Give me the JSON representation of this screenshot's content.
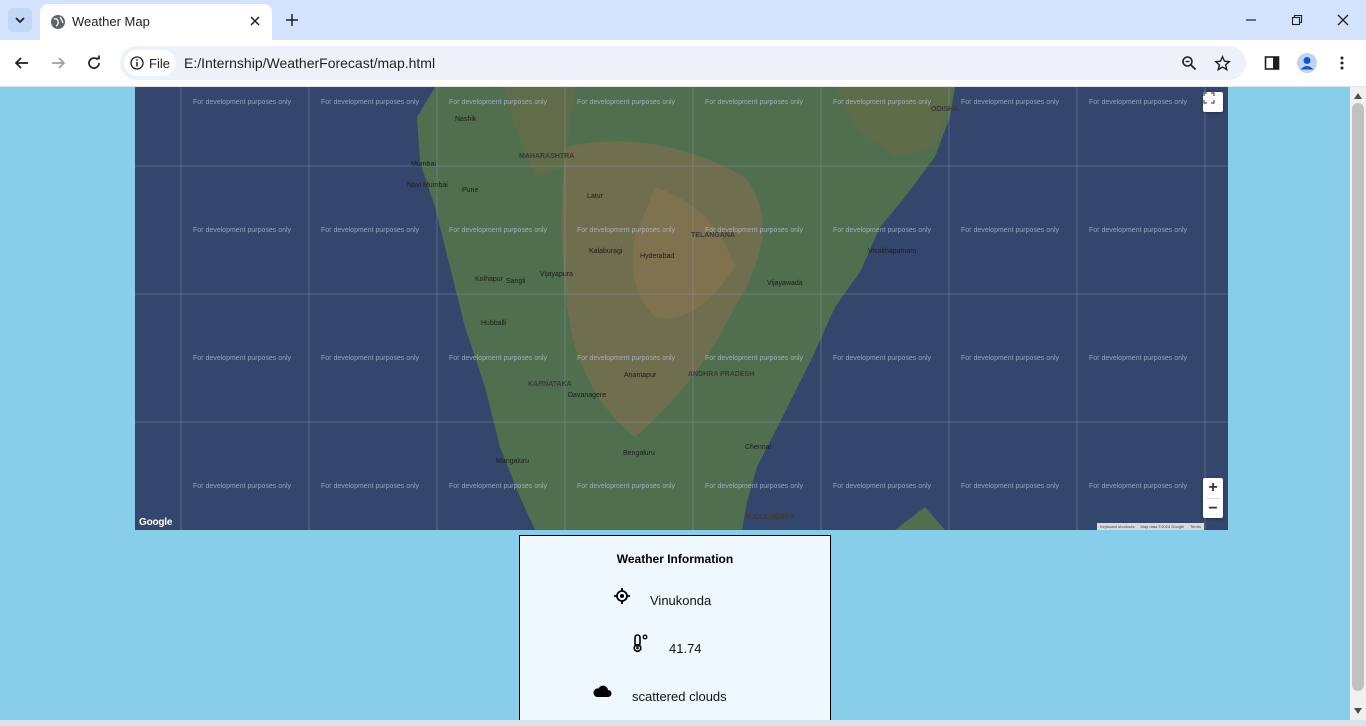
{
  "browser": {
    "tab_title": "Weather Map",
    "address_chip": "File",
    "url": "E:/Internship/WeatherForecast/map.html"
  },
  "map": {
    "watermark": "For development purposes only",
    "labels": [
      "Nashik",
      "MAHARASHTRA",
      "Mumbai",
      "Navi Mumbai",
      "Pune",
      "Latur",
      "Kalaburagi",
      "Hyderabad",
      "TELANGANA",
      "Vijayawada",
      "Visakhapatnam",
      "Vijayapura",
      "Kolhapur",
      "Sangli",
      "Hubballi",
      "KARNATAKA",
      "Davanagere",
      "ANDHRA PRADESH",
      "Anantapur",
      "Bengaluru",
      "Chennai",
      "Mangaluru",
      "PUDUCHERRY",
      "ODISHA"
    ],
    "logo_text": "Google",
    "attribution": [
      "Keyboard shortcuts",
      "Map data ©2024 Google",
      "Terms"
    ],
    "zoom_in": "+",
    "zoom_out": "−"
  },
  "weather": {
    "heading": "Weather Information",
    "location": "Vinukonda",
    "temperature": "41.74",
    "description": "scattered clouds"
  }
}
